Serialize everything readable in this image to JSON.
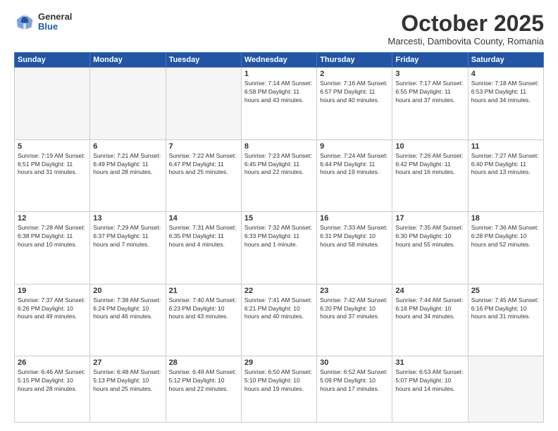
{
  "logo": {
    "general": "General",
    "blue": "Blue"
  },
  "title": "October 2025",
  "location": "Marcesti, Dambovita County, Romania",
  "headers": [
    "Sunday",
    "Monday",
    "Tuesday",
    "Wednesday",
    "Thursday",
    "Friday",
    "Saturday"
  ],
  "weeks": [
    [
      {
        "day": "",
        "info": ""
      },
      {
        "day": "",
        "info": ""
      },
      {
        "day": "",
        "info": ""
      },
      {
        "day": "1",
        "info": "Sunrise: 7:14 AM\nSunset: 6:58 PM\nDaylight: 11 hours\nand 43 minutes."
      },
      {
        "day": "2",
        "info": "Sunrise: 7:16 AM\nSunset: 6:57 PM\nDaylight: 11 hours\nand 40 minutes."
      },
      {
        "day": "3",
        "info": "Sunrise: 7:17 AM\nSunset: 6:55 PM\nDaylight: 11 hours\nand 37 minutes."
      },
      {
        "day": "4",
        "info": "Sunrise: 7:18 AM\nSunset: 6:53 PM\nDaylight: 11 hours\nand 34 minutes."
      }
    ],
    [
      {
        "day": "5",
        "info": "Sunrise: 7:19 AM\nSunset: 6:51 PM\nDaylight: 11 hours\nand 31 minutes."
      },
      {
        "day": "6",
        "info": "Sunrise: 7:21 AM\nSunset: 6:49 PM\nDaylight: 11 hours\nand 28 minutes."
      },
      {
        "day": "7",
        "info": "Sunrise: 7:22 AM\nSunset: 6:47 PM\nDaylight: 11 hours\nand 25 minutes."
      },
      {
        "day": "8",
        "info": "Sunrise: 7:23 AM\nSunset: 6:45 PM\nDaylight: 11 hours\nand 22 minutes."
      },
      {
        "day": "9",
        "info": "Sunrise: 7:24 AM\nSunset: 6:44 PM\nDaylight: 11 hours\nand 19 minutes."
      },
      {
        "day": "10",
        "info": "Sunrise: 7:26 AM\nSunset: 6:42 PM\nDaylight: 11 hours\nand 16 minutes."
      },
      {
        "day": "11",
        "info": "Sunrise: 7:27 AM\nSunset: 6:40 PM\nDaylight: 11 hours\nand 13 minutes."
      }
    ],
    [
      {
        "day": "12",
        "info": "Sunrise: 7:28 AM\nSunset: 6:38 PM\nDaylight: 11 hours\nand 10 minutes."
      },
      {
        "day": "13",
        "info": "Sunrise: 7:29 AM\nSunset: 6:37 PM\nDaylight: 11 hours\nand 7 minutes."
      },
      {
        "day": "14",
        "info": "Sunrise: 7:31 AM\nSunset: 6:35 PM\nDaylight: 11 hours\nand 4 minutes."
      },
      {
        "day": "15",
        "info": "Sunrise: 7:32 AM\nSunset: 6:33 PM\nDaylight: 11 hours\nand 1 minute."
      },
      {
        "day": "16",
        "info": "Sunrise: 7:33 AM\nSunset: 6:31 PM\nDaylight: 10 hours\nand 58 minutes."
      },
      {
        "day": "17",
        "info": "Sunrise: 7:35 AM\nSunset: 6:30 PM\nDaylight: 10 hours\nand 55 minutes."
      },
      {
        "day": "18",
        "info": "Sunrise: 7:36 AM\nSunset: 6:28 PM\nDaylight: 10 hours\nand 52 minutes."
      }
    ],
    [
      {
        "day": "19",
        "info": "Sunrise: 7:37 AM\nSunset: 6:26 PM\nDaylight: 10 hours\nand 49 minutes."
      },
      {
        "day": "20",
        "info": "Sunrise: 7:38 AM\nSunset: 6:24 PM\nDaylight: 10 hours\nand 46 minutes."
      },
      {
        "day": "21",
        "info": "Sunrise: 7:40 AM\nSunset: 6:23 PM\nDaylight: 10 hours\nand 43 minutes."
      },
      {
        "day": "22",
        "info": "Sunrise: 7:41 AM\nSunset: 6:21 PM\nDaylight: 10 hours\nand 40 minutes."
      },
      {
        "day": "23",
        "info": "Sunrise: 7:42 AM\nSunset: 6:20 PM\nDaylight: 10 hours\nand 37 minutes."
      },
      {
        "day": "24",
        "info": "Sunrise: 7:44 AM\nSunset: 6:18 PM\nDaylight: 10 hours\nand 34 minutes."
      },
      {
        "day": "25",
        "info": "Sunrise: 7:45 AM\nSunset: 6:16 PM\nDaylight: 10 hours\nand 31 minutes."
      }
    ],
    [
      {
        "day": "26",
        "info": "Sunrise: 6:46 AM\nSunset: 5:15 PM\nDaylight: 10 hours\nand 28 minutes."
      },
      {
        "day": "27",
        "info": "Sunrise: 6:48 AM\nSunset: 5:13 PM\nDaylight: 10 hours\nand 25 minutes."
      },
      {
        "day": "28",
        "info": "Sunrise: 6:49 AM\nSunset: 5:12 PM\nDaylight: 10 hours\nand 22 minutes."
      },
      {
        "day": "29",
        "info": "Sunrise: 6:50 AM\nSunset: 5:10 PM\nDaylight: 10 hours\nand 19 minutes."
      },
      {
        "day": "30",
        "info": "Sunrise: 6:52 AM\nSunset: 5:09 PM\nDaylight: 10 hours\nand 17 minutes."
      },
      {
        "day": "31",
        "info": "Sunrise: 6:53 AM\nSunset: 5:07 PM\nDaylight: 10 hours\nand 14 minutes."
      },
      {
        "day": "",
        "info": ""
      }
    ]
  ]
}
